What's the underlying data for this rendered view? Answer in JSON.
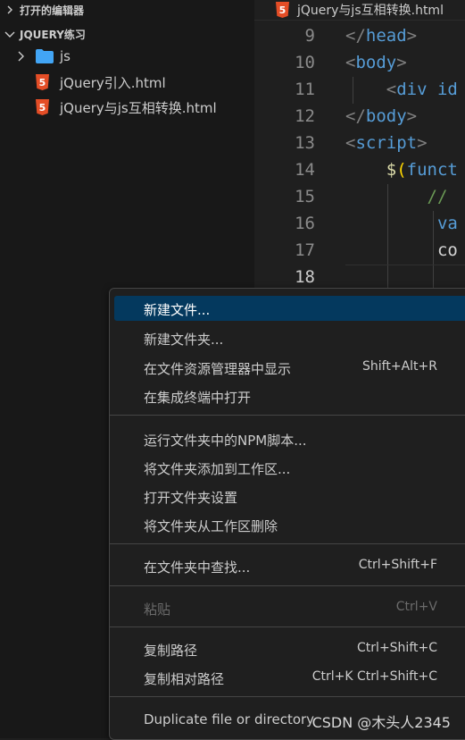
{
  "sidebar": {
    "open_editors_title": "打开的编辑器",
    "workspace_title": "JQUERY练习",
    "tree": [
      {
        "label": "js",
        "icon": "folder-icon"
      },
      {
        "label": "jQuery引入.html",
        "icon": "html5-icon"
      },
      {
        "label": "jQuery与js互相转换.html",
        "icon": "html5-icon"
      }
    ]
  },
  "editor": {
    "tab_label": "jQuery与js互相转换.html",
    "active_line": "18",
    "lines": [
      {
        "n": "9",
        "p1": "</",
        "tag": "head",
        "p2": ">"
      },
      {
        "n": "10",
        "p1": "<",
        "tag": "body",
        "p2": ">"
      },
      {
        "n": "11",
        "indent": "    ",
        "p1": "<",
        "tag": "div id",
        "p2": ""
      },
      {
        "n": "12",
        "p1": "</",
        "tag": "body",
        "p2": ">"
      },
      {
        "n": "13",
        "p1": "<",
        "tag": "script",
        "p2": ">"
      },
      {
        "n": "14",
        "indent": "    ",
        "fn": "$",
        "br": "(",
        "kw": "funct"
      },
      {
        "n": "15",
        "indent": "        ",
        "cm": "//"
      },
      {
        "n": "16",
        "indent": "         ",
        "kw": "va"
      },
      {
        "n": "17",
        "indent": "         ",
        "text": "co"
      },
      {
        "n": "18"
      }
    ]
  },
  "context_menu": {
    "items": [
      {
        "label": "新建文件...",
        "shortcut": "",
        "state": "selected"
      },
      {
        "label": "新建文件夹...",
        "shortcut": "",
        "state": "normal"
      },
      {
        "label": "在文件资源管理器中显示",
        "shortcut": "Shift+Alt+R",
        "state": "normal"
      },
      {
        "label": "在集成终端中打开",
        "shortcut": "",
        "state": "normal"
      },
      {
        "label": "运行文件夹中的NPM脚本...",
        "shortcut": "",
        "state": "normal"
      },
      {
        "label": "将文件夹添加到工作区...",
        "shortcut": "",
        "state": "normal"
      },
      {
        "label": "打开文件夹设置",
        "shortcut": "",
        "state": "normal"
      },
      {
        "label": "将文件夹从工作区删除",
        "shortcut": "",
        "state": "normal"
      },
      {
        "label": "在文件夹中查找...",
        "shortcut": "Ctrl+Shift+F",
        "state": "normal"
      },
      {
        "label": "粘贴",
        "shortcut": "Ctrl+V",
        "state": "disabled"
      },
      {
        "label": "复制路径",
        "shortcut": "Ctrl+Shift+C",
        "state": "normal"
      },
      {
        "label": "复制相对路径",
        "shortcut": "Ctrl+K Ctrl+Shift+C",
        "state": "normal"
      },
      {
        "label": "Duplicate file or directory",
        "shortcut": "",
        "state": "normal"
      }
    ]
  },
  "watermark": "CSDN @木头人2345",
  "colors": {
    "selection": "#04395e",
    "html_tag": "#569cd6",
    "html5_badge": "#e44d26",
    "folder": "#42a5f5"
  }
}
